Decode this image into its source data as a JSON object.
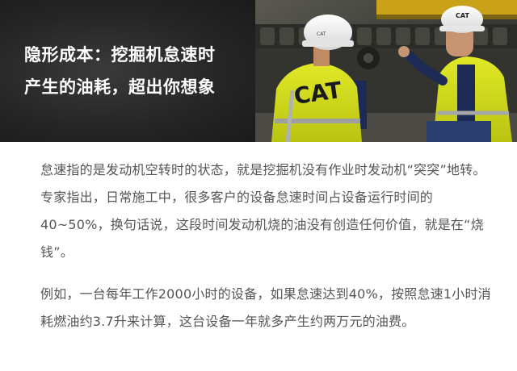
{
  "hero": {
    "title_line1": "隐形成本：挖掘机怠速时",
    "title_line2": "产生的油耗，超出你想象",
    "badge_text": "CAT",
    "helmet_text": "CAT"
  },
  "article": {
    "paragraph1": "怠速指的是发动机空转时的状态，就是挖掘机没有作业时发动机“突突”地转。专家指出，日常施工中，很多客户的设备怠速时间占设备运行时间的40~50%，换句话说，这段时间发动机烧的油没有创造任何价值，就是在“烧钱”。",
    "paragraph2": "例如，一台每年工作2000小时的设备，如果怠速达到40%，按照怠速1小时消耗燃油约3.7升来计算，这台设备一年就多产生约两万元的油费。"
  },
  "colors": {
    "hero_background": "#262626",
    "hero_title": "#ffffff",
    "body_text": "#555555",
    "vest_yellow": "#d8e21a",
    "helmet_white": "#f2f2f2"
  }
}
